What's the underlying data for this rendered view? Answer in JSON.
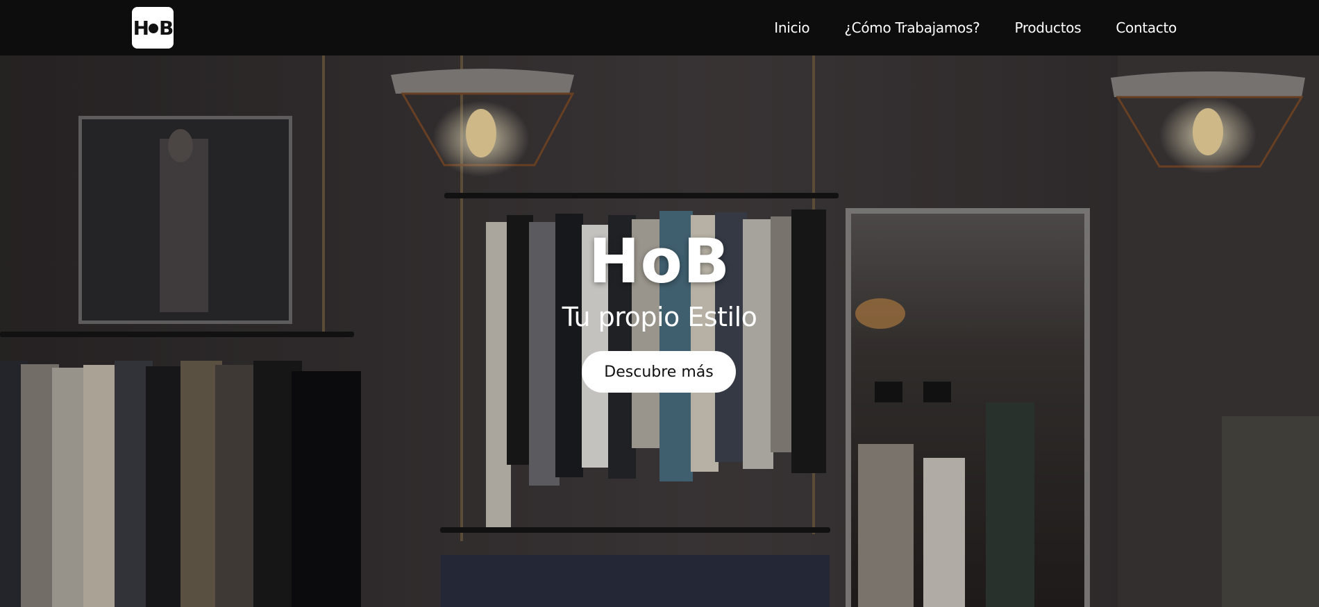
{
  "brand": {
    "logo_alt": "HoB logo"
  },
  "nav": {
    "items": [
      {
        "label": "Inicio"
      },
      {
        "label": "¿Cómo Trabajamos?"
      },
      {
        "label": "Productos"
      },
      {
        "label": "Contacto"
      }
    ]
  },
  "hero": {
    "title": "HoB",
    "subtitle": "Tu propio Estilo",
    "cta_label": "Descubre más",
    "background": "clothing store interior with hanging garment racks, pendant lamps, framed poster and mirror"
  },
  "colors": {
    "header_bg": "#0d0d0d",
    "hero_text": "#ffffff",
    "button_bg": "#ffffff",
    "button_text": "#111111"
  }
}
